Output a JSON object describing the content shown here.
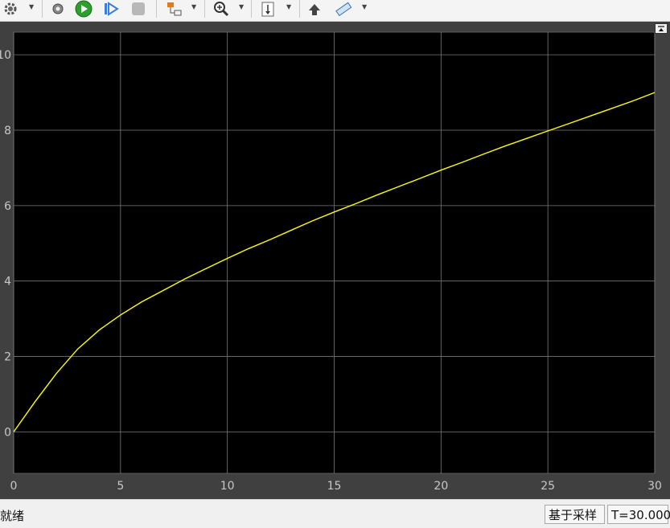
{
  "toolbar": {
    "icons": [
      "gear-icon",
      "settings-gear-icon",
      "run-icon",
      "step-forward-icon",
      "stop-icon",
      "highlight-block-icon",
      "zoom-in-icon",
      "scale-axes-icon",
      "restore-icon",
      "measure-icon"
    ]
  },
  "chart_data": {
    "type": "line",
    "title": "",
    "xlabel": "",
    "ylabel": "",
    "xlim": [
      0,
      30
    ],
    "ylim": [
      -1.1,
      10.6
    ],
    "xticks": [
      0,
      5,
      10,
      15,
      20,
      25,
      30
    ],
    "xtick_labels": [
      "0",
      "5",
      "10",
      "15",
      "20",
      "25",
      "30"
    ],
    "yticks": [
      0,
      2,
      4,
      6,
      8,
      10
    ],
    "ytick_labels": [
      "0",
      "2",
      "4",
      "6",
      "8",
      "10"
    ],
    "grid": true,
    "colors": {
      "plot_bg": "#000000",
      "line": "#ffff00",
      "grid": "#7a7a7a",
      "axes_bg": "#404040",
      "tick_label": "#c8c8c8"
    },
    "series": [
      {
        "x": [
          0,
          1,
          2,
          3,
          4,
          5,
          6,
          7,
          8,
          9,
          10,
          11,
          12,
          13,
          14,
          15,
          16,
          17,
          18,
          19,
          20,
          21,
          22,
          23,
          24,
          25,
          26,
          27,
          28,
          29,
          30
        ],
        "y": [
          0,
          0.8,
          1.55,
          2.2,
          2.7,
          3.1,
          3.45,
          3.75,
          4.05,
          4.33,
          4.6,
          4.86,
          5.1,
          5.35,
          5.6,
          5.83,
          6.05,
          6.28,
          6.5,
          6.72,
          6.94,
          7.15,
          7.37,
          7.58,
          7.78,
          7.98,
          8.18,
          8.38,
          8.58,
          8.78,
          9.0
        ]
      }
    ]
  },
  "statusbar": {
    "ready": "就绪",
    "mode": "基于采样",
    "time": "T=30.000"
  }
}
